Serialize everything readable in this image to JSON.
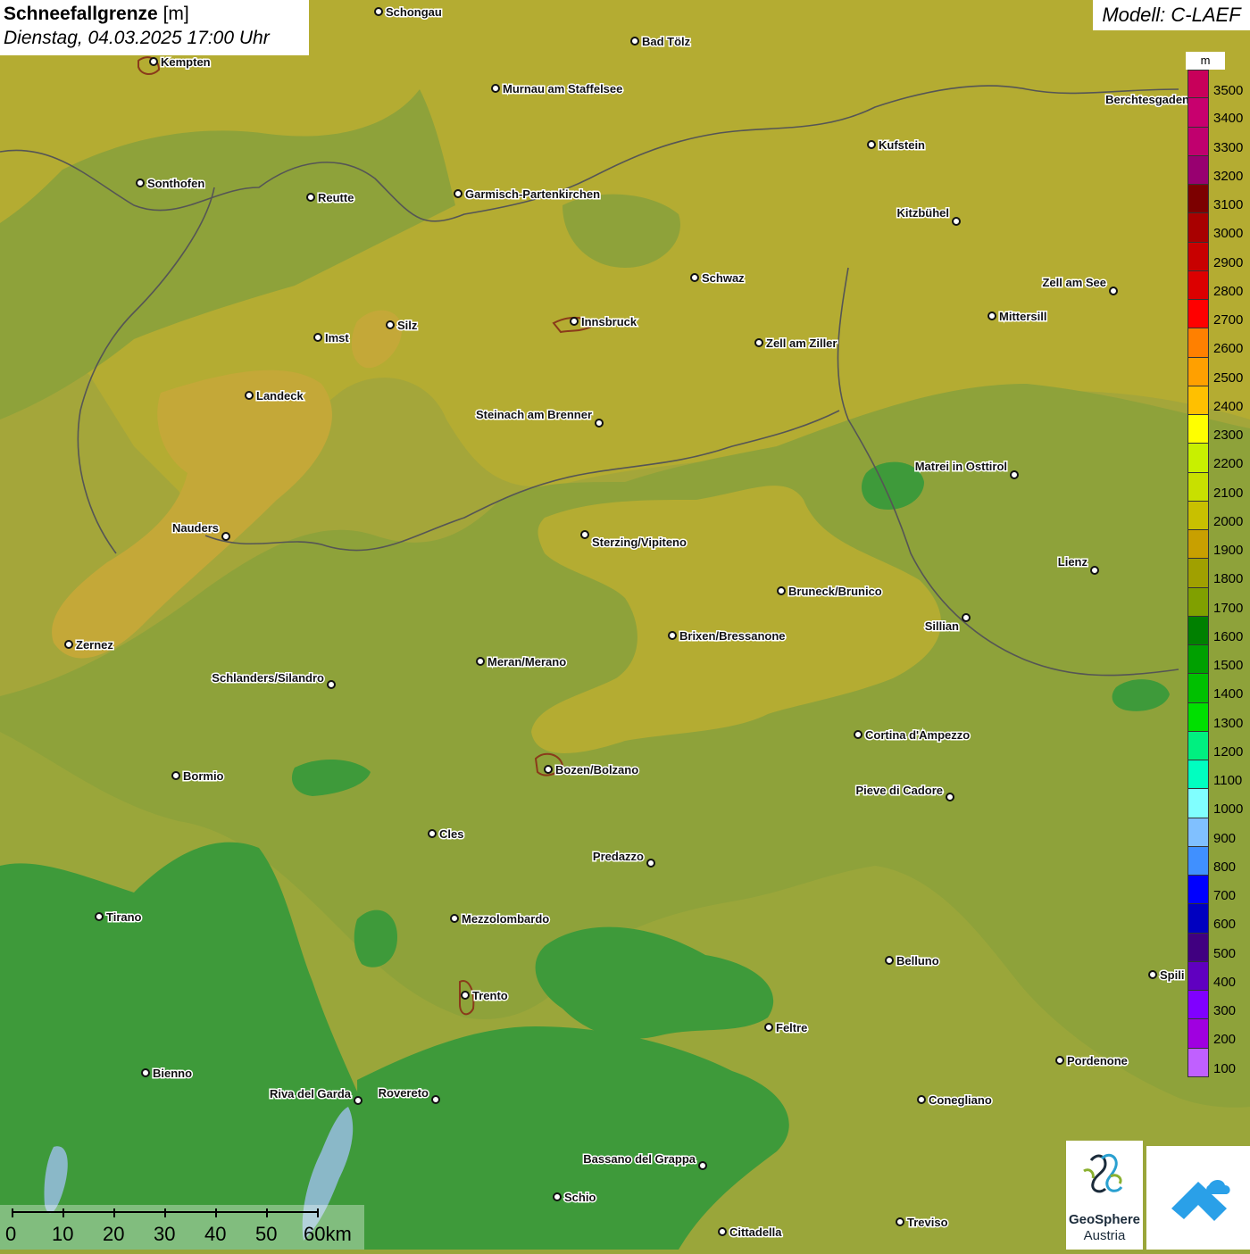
{
  "header": {
    "title_bold": "Schneefallgrenze",
    "title_unit": "[m]",
    "datetime": "Dienstag, 04.03.2025 17:00 Uhr",
    "model": "Modell: C-LAEF"
  },
  "legend": {
    "unit": "m",
    "colors": [
      "#c8005a",
      "#c8006e",
      "#c0006e",
      "#980070",
      "#7c0000",
      "#a80000",
      "#c80000",
      "#dc0000",
      "#ff0000",
      "#ff8000",
      "#ffa000",
      "#ffc000",
      "#ffff00",
      "#c8f000",
      "#c8e000",
      "#c8c000",
      "#c8a000",
      "#a0a000",
      "#80a000",
      "#008000",
      "#00a000",
      "#00c000",
      "#00e000",
      "#00f080",
      "#00ffc0",
      "#80ffff",
      "#80c0ff",
      "#4090ff",
      "#0000ff",
      "#0000c0",
      "#400080",
      "#6000c0",
      "#8000ff",
      "#a000e0",
      "#c060ff"
    ],
    "values": [
      "3500",
      "3400",
      "3300",
      "3200",
      "3100",
      "3000",
      "2900",
      "2800",
      "2700",
      "2600",
      "2500",
      "2400",
      "2300",
      "2200",
      "2100",
      "2000",
      "1900",
      "1800",
      "1700",
      "1600",
      "1500",
      "1400",
      "1300",
      "1200",
      "1100",
      "1000",
      "900",
      "800",
      "700",
      "600",
      "500",
      "400",
      "300",
      "200",
      "100"
    ]
  },
  "cities": [
    {
      "name": "Schongau"
    },
    {
      "name": "Bad Tölz"
    },
    {
      "name": "Kempten"
    },
    {
      "name": "Murnau am Staffelsee"
    },
    {
      "name": "Berchtesgaden"
    },
    {
      "name": "Kufstein"
    },
    {
      "name": "Sonthofen"
    },
    {
      "name": "Reutte"
    },
    {
      "name": "Garmisch-Partenkirchen"
    },
    {
      "name": "Kitzbühel"
    },
    {
      "name": "Schwaz"
    },
    {
      "name": "Zell am See"
    },
    {
      "name": "Innsbruck"
    },
    {
      "name": "Mittersill"
    },
    {
      "name": "Imst"
    },
    {
      "name": "Silz"
    },
    {
      "name": "Zell am Ziller"
    },
    {
      "name": "Landeck"
    },
    {
      "name": "Steinach am Brenner"
    },
    {
      "name": "Matrei in Osttirol"
    },
    {
      "name": "Nauders"
    },
    {
      "name": "Sterzing/Vipiteno"
    },
    {
      "name": "Lienz"
    },
    {
      "name": "Bruneck/Brunico"
    },
    {
      "name": "Sillian"
    },
    {
      "name": "Zernez"
    },
    {
      "name": "Brixen/Bressanone"
    },
    {
      "name": "Meran/Merano"
    },
    {
      "name": "Schlanders/Silandro"
    },
    {
      "name": "Cortina d'Ampezzo"
    },
    {
      "name": "Bozen/Bolzano"
    },
    {
      "name": "Bormio"
    },
    {
      "name": "Pieve di Cadore"
    },
    {
      "name": "Cles"
    },
    {
      "name": "Predazzo"
    },
    {
      "name": "Tirano"
    },
    {
      "name": "Mezzolombardo"
    },
    {
      "name": "Belluno"
    },
    {
      "name": "Spili"
    },
    {
      "name": "Trento"
    },
    {
      "name": "Feltre"
    },
    {
      "name": "Pordenone"
    },
    {
      "name": "Bienno"
    },
    {
      "name": "Riva del Garda"
    },
    {
      "name": "Rovereto"
    },
    {
      "name": "Conegliano"
    },
    {
      "name": "Bassano del Grappa"
    },
    {
      "name": "Schio"
    },
    {
      "name": "Treviso"
    },
    {
      "name": "Cittadella"
    }
  ],
  "scalebar": {
    "labels": [
      "0",
      "10",
      "20",
      "30",
      "40",
      "50",
      "60km"
    ]
  },
  "logos": {
    "geosphere_line1": "GeoSphere",
    "geosphere_line2": "Austria"
  }
}
